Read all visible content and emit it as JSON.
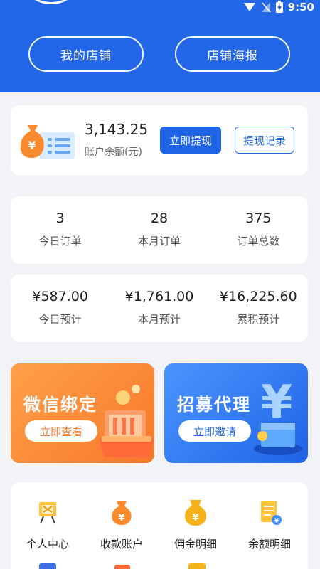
{
  "status_bar": {
    "time": "9:50"
  },
  "header": {
    "my_store": "我的店铺",
    "store_poster": "店铺海报"
  },
  "balance": {
    "amount": "3,143.25",
    "label": "账户余额(元)",
    "withdraw_button": "立即提现",
    "withdraw_records_button": "提现记录"
  },
  "orders": [
    {
      "value": "3",
      "label": "今日订单"
    },
    {
      "value": "28",
      "label": "本月订单"
    },
    {
      "value": "375",
      "label": "订单总数"
    }
  ],
  "estimates": [
    {
      "value": "¥587.00",
      "label": "今日预计"
    },
    {
      "value": "¥1,761.00",
      "label": "本月预计"
    },
    {
      "value": "¥16,225.60",
      "label": "累积预计"
    }
  ],
  "banners": {
    "wechat": {
      "title": "微信绑定",
      "button": "立即查看",
      "color": "#fb8a2e"
    },
    "agent": {
      "title": "招募代理",
      "button": "立即邀请",
      "color": "#2f7df0"
    }
  },
  "menu": [
    {
      "label": "个人中心",
      "icon": "easel-icon"
    },
    {
      "label": "收款账户",
      "icon": "money-bag-icon"
    },
    {
      "label": "佣金明细",
      "icon": "commission-bag-icon"
    },
    {
      "label": "余额明细",
      "icon": "document-coin-icon"
    }
  ],
  "colors": {
    "primary": "#2366e8",
    "orange": "#fb8a2e"
  }
}
